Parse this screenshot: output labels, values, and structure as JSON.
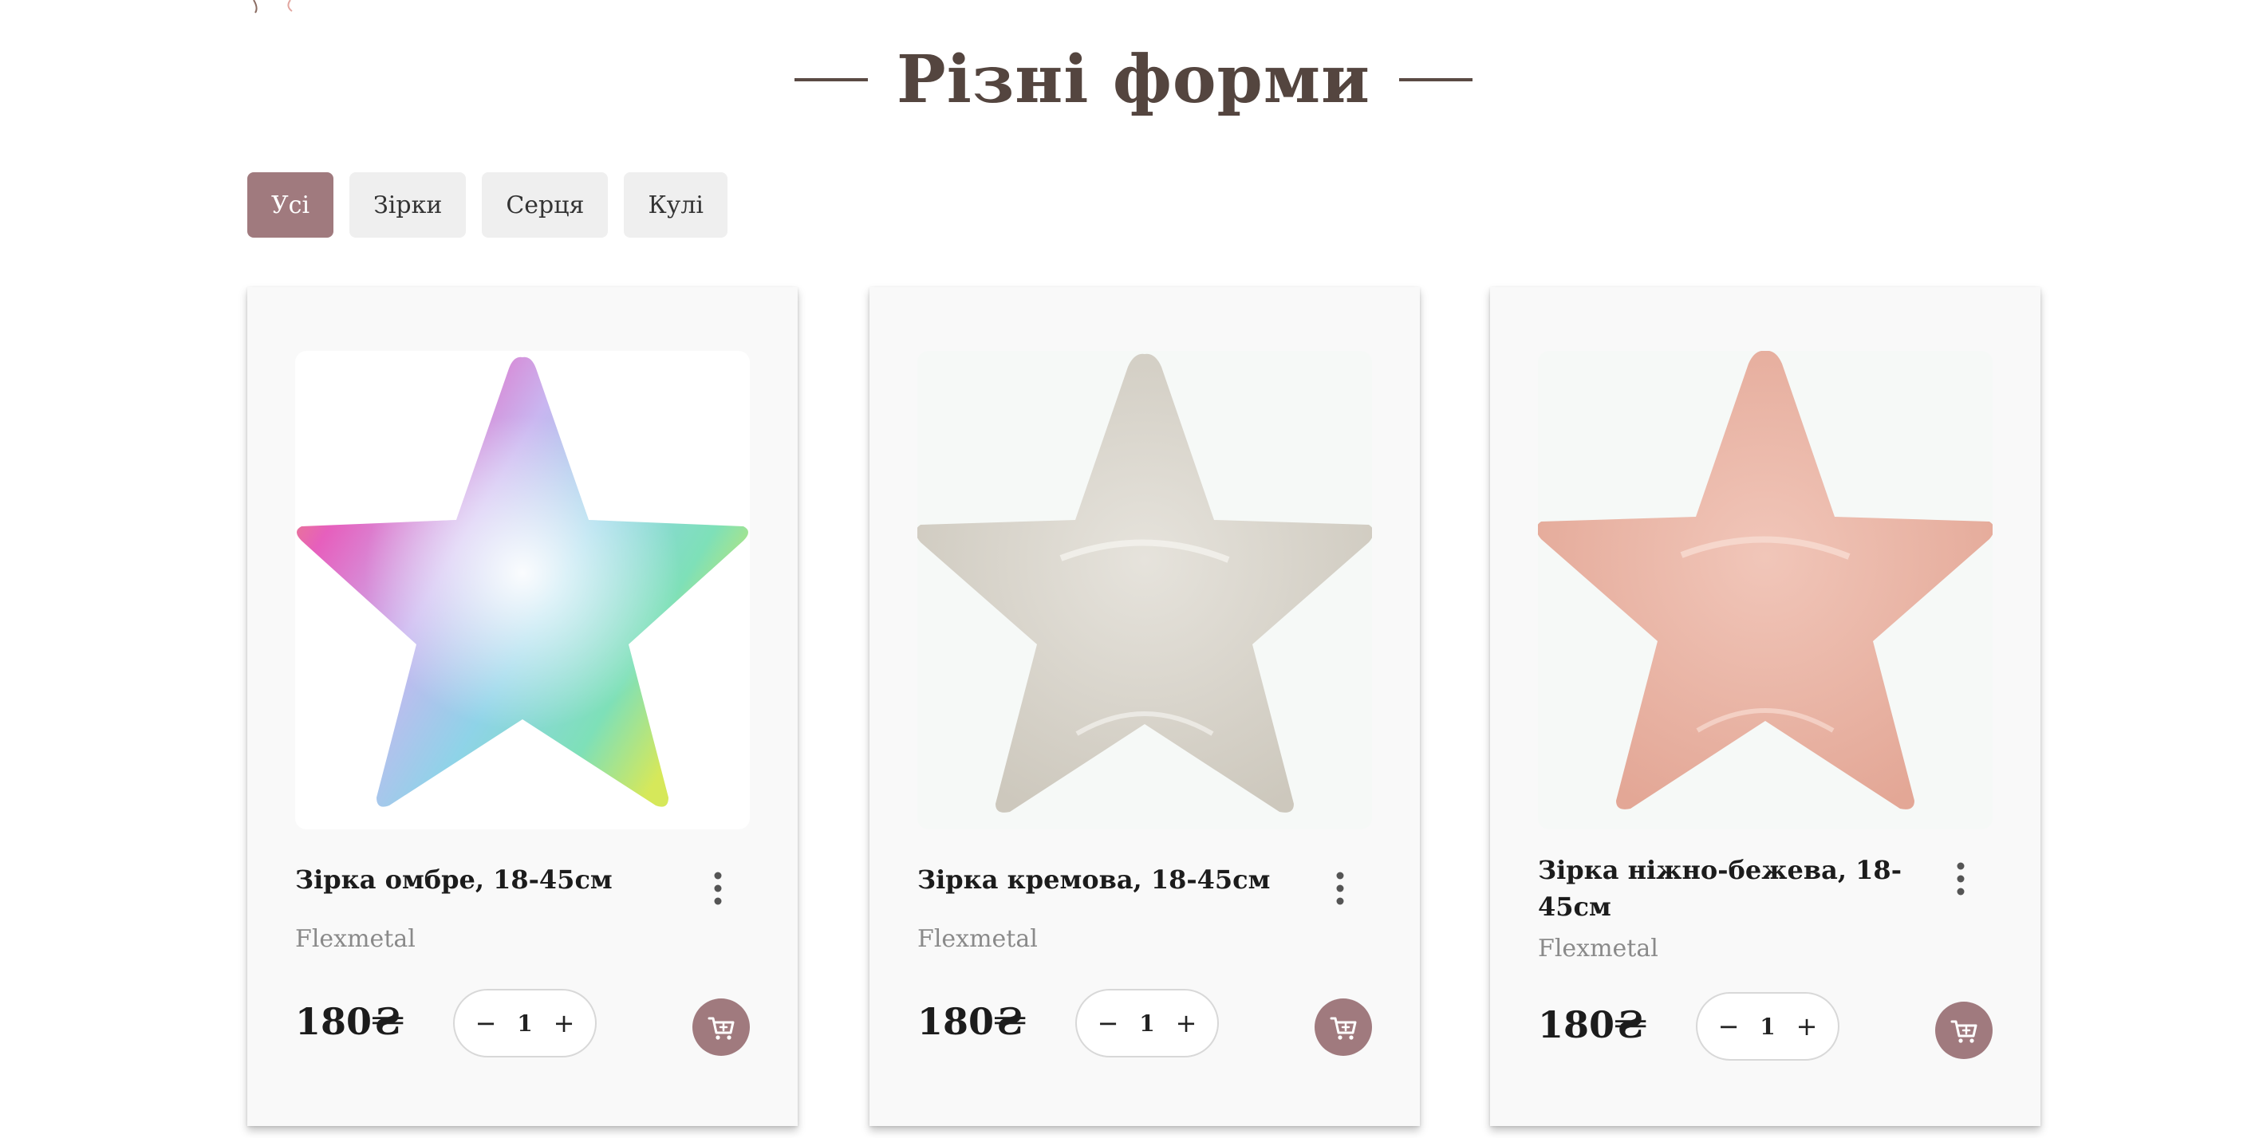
{
  "section": {
    "title": "Різні форми"
  },
  "filters": [
    {
      "label": "Усі",
      "active": true
    },
    {
      "label": "Зірки",
      "active": false
    },
    {
      "label": "Серця",
      "active": false
    },
    {
      "label": "Кулі",
      "active": false
    }
  ],
  "products": [
    {
      "name": "Зірка омбре, 18-45см",
      "brand": "Flexmetal",
      "price": "180₴",
      "quantity": "1",
      "image_icon": "rainbow-star-balloon"
    },
    {
      "name": "Зірка кремова, 18-45см",
      "brand": "Flexmetal",
      "price": "180₴",
      "quantity": "1",
      "image_icon": "cream-star-balloon"
    },
    {
      "name": "Зірка ніжно-бежева, 18-45см",
      "brand": "Flexmetal",
      "price": "180₴",
      "quantity": "1",
      "image_icon": "beige-star-balloon"
    }
  ],
  "controls": {
    "decrement": "−",
    "increment": "+"
  },
  "colors": {
    "accent": "#a07a7e",
    "title": "#54453f",
    "filter_inactive": "#efefef",
    "card_bg": "#f9f9f9",
    "brand_text": "#8a8a8a",
    "star_cream": "#dcd8cf",
    "star_beige": "#ebb8aa"
  }
}
